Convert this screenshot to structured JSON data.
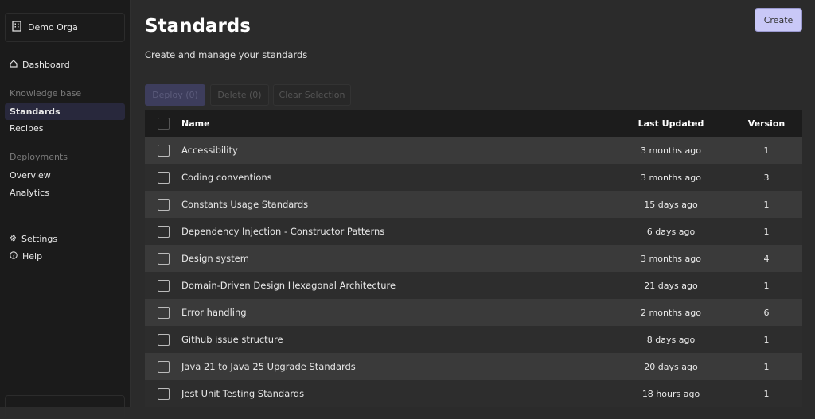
{
  "sidebar": {
    "org": "Demo Orga",
    "dashboard": "Dashboard",
    "kb_section": "Knowledge base",
    "standards": "Standards",
    "recipes": "Recipes",
    "deploy_section": "Deployments",
    "overview": "Overview",
    "analytics": "Analytics",
    "settings": "Settings",
    "help": "Help"
  },
  "header": {
    "title": "Standards",
    "subtitle": "Create and manage your standards",
    "create": "Create"
  },
  "actions": {
    "deploy": "Deploy (0)",
    "delete": "Delete (0)",
    "clear": "Clear Selection"
  },
  "table": {
    "columns": [
      "Name",
      "Last Updated",
      "Version"
    ],
    "rows": [
      {
        "name": "Accessibility",
        "updated": "3 months ago",
        "version": "1"
      },
      {
        "name": "Coding conventions",
        "updated": "3 months ago",
        "version": "3"
      },
      {
        "name": "Constants Usage Standards",
        "updated": "15 days ago",
        "version": "1"
      },
      {
        "name": "Dependency Injection - Constructor Patterns",
        "updated": "6 days ago",
        "version": "1"
      },
      {
        "name": "Design system",
        "updated": "3 months ago",
        "version": "4"
      },
      {
        "name": "Domain-Driven Design Hexagonal Architecture",
        "updated": "21 days ago",
        "version": "1"
      },
      {
        "name": "Error handling",
        "updated": "2 months ago",
        "version": "6"
      },
      {
        "name": "Github issue structure",
        "updated": "8 days ago",
        "version": "1"
      },
      {
        "name": "Java 21 to Java 25 Upgrade Standards",
        "updated": "20 days ago",
        "version": "1"
      },
      {
        "name": "Jest Unit Testing Standards",
        "updated": "18 hours ago",
        "version": "1"
      }
    ]
  }
}
